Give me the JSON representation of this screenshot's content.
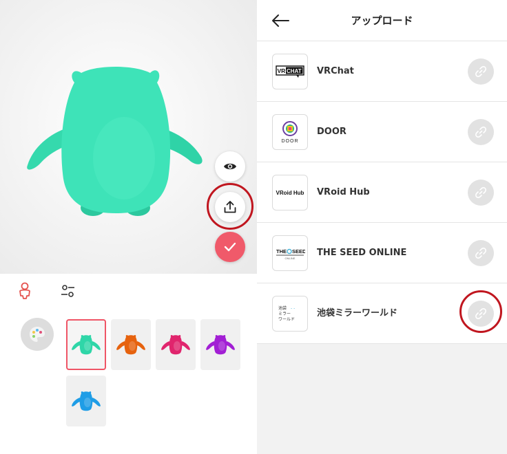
{
  "editor": {
    "swatches": [
      {
        "name": "teal",
        "color": "#2fd6a8",
        "selected": true
      },
      {
        "name": "orange",
        "color": "#e6620e",
        "selected": false
      },
      {
        "name": "pink",
        "color": "#e0256d",
        "selected": false
      },
      {
        "name": "purple",
        "color": "#a21fd4",
        "selected": false
      },
      {
        "name": "blue",
        "color": "#1f9de6",
        "selected": false
      }
    ],
    "character_color": "#3ee3b8",
    "accent_color": "#f05a6a",
    "icons": {
      "eye": "eye-icon",
      "upload": "upload-icon",
      "check": "check-icon",
      "person": "person-outline-icon",
      "sliders": "sliders-icon",
      "palette": "palette-icon"
    }
  },
  "upload_screen": {
    "title": "アップロード",
    "back_icon": "arrow-left-icon",
    "services": [
      {
        "name": "VRChat",
        "logo_text": "VRCHAT"
      },
      {
        "name": "DOOR",
        "logo_text": "DOOR"
      },
      {
        "name": "VRoid Hub",
        "logo_text": "VRoid Hub"
      },
      {
        "name": "THE SEED ONLINE",
        "logo_text": "THE SEED"
      },
      {
        "name": "池袋ミラーワールド",
        "logo_text": "池袋ミラーワールド"
      }
    ],
    "link_icon": "link-icon"
  }
}
